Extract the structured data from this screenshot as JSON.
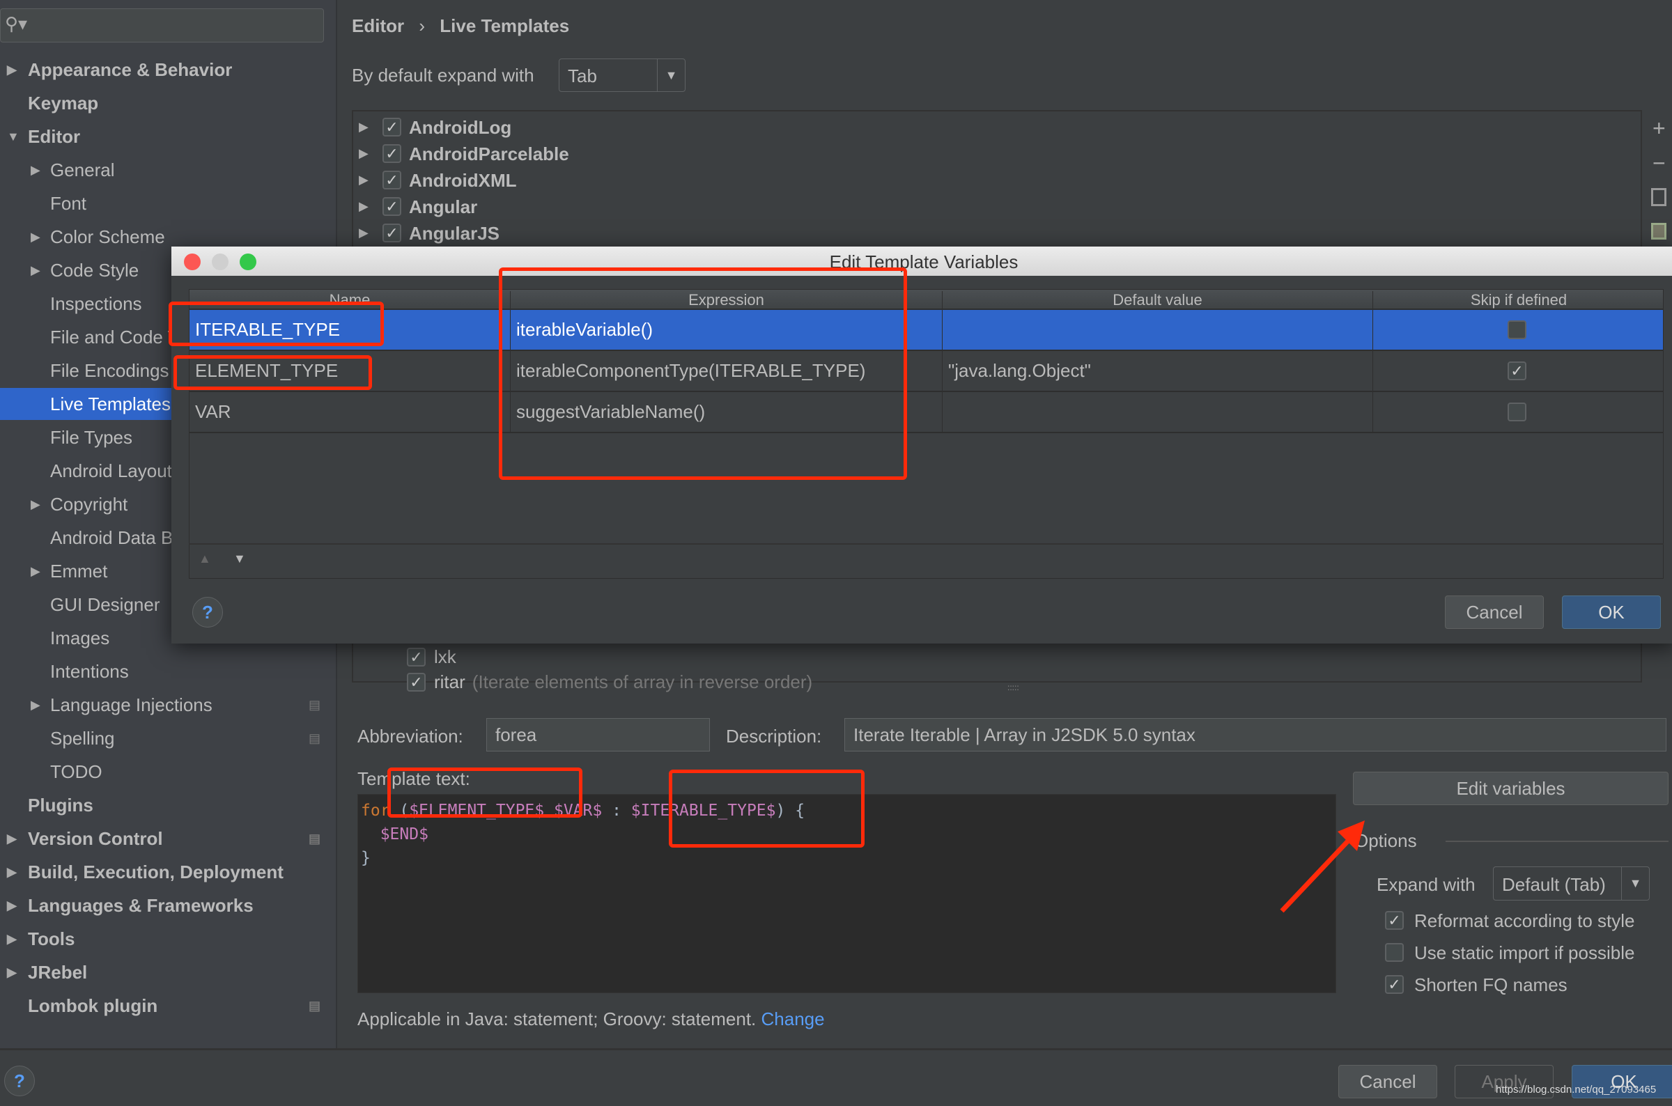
{
  "sidebar": {
    "items": [
      {
        "label": "Appearance & Behavior",
        "level": 0,
        "arrow": "right"
      },
      {
        "label": "Keymap",
        "level": 0
      },
      {
        "label": "Editor",
        "level": 0,
        "arrow": "down"
      },
      {
        "label": "General",
        "level": 1,
        "arrow": "right"
      },
      {
        "label": "Font",
        "level": 1
      },
      {
        "label": "Color Scheme",
        "level": 1,
        "arrow": "right"
      },
      {
        "label": "Code Style",
        "level": 1,
        "arrow": "right"
      },
      {
        "label": "Inspections",
        "level": 1
      },
      {
        "label": "File and Code Templates",
        "level": 1
      },
      {
        "label": "File Encodings",
        "level": 1
      },
      {
        "label": "Live Templates",
        "level": 1,
        "selected": true
      },
      {
        "label": "File Types",
        "level": 1
      },
      {
        "label": "Android Layout Editor",
        "level": 1
      },
      {
        "label": "Copyright",
        "level": 1,
        "arrow": "right"
      },
      {
        "label": "Android Data Binding",
        "level": 1
      },
      {
        "label": "Emmet",
        "level": 1,
        "arrow": "right"
      },
      {
        "label": "GUI Designer",
        "level": 1
      },
      {
        "label": "Images",
        "level": 1
      },
      {
        "label": "Intentions",
        "level": 1
      },
      {
        "label": "Language Injections",
        "level": 1,
        "arrow": "right",
        "pin": true
      },
      {
        "label": "Spelling",
        "level": 1,
        "pin": true
      },
      {
        "label": "TODO",
        "level": 1
      },
      {
        "label": "Plugins",
        "level": 0
      },
      {
        "label": "Version Control",
        "level": 0,
        "arrow": "right",
        "pin": true
      },
      {
        "label": "Build, Execution, Deployment",
        "level": 0,
        "arrow": "right"
      },
      {
        "label": "Languages & Frameworks",
        "level": 0,
        "arrow": "right"
      },
      {
        "label": "Tools",
        "level": 0,
        "arrow": "right"
      },
      {
        "label": "JRebel",
        "level": 0,
        "arrow": "right"
      },
      {
        "label": "Lombok plugin",
        "level": 0,
        "pin": true
      }
    ]
  },
  "breadcrumb": {
    "parent": "Editor",
    "sep": "›",
    "current": "Live Templates"
  },
  "expand": {
    "label": "By default expand with",
    "value": "Tab"
  },
  "groups": [
    "AndroidLog",
    "AndroidParcelable",
    "AndroidXML",
    "Angular",
    "AngularJS"
  ],
  "templates_behind": [
    {
      "abbr": "lxk",
      "desc": ""
    },
    {
      "abbr": "ritar",
      "desc": "(Iterate elements of array in reverse order)"
    }
  ],
  "dialog": {
    "title": "Edit Template Variables",
    "columns": [
      "Name",
      "Expression",
      "Default value",
      "Skip if defined"
    ],
    "rows": [
      {
        "name": "ITERABLE_TYPE",
        "expression": "iterableVariable()",
        "default": "",
        "skip": false,
        "selected": true
      },
      {
        "name": "ELEMENT_TYPE",
        "expression": "iterableComponentType(ITERABLE_TYPE)",
        "default": "\"java.lang.Object\"",
        "skip": true
      },
      {
        "name": "VAR",
        "expression": "suggestVariableName()",
        "default": "",
        "skip": false
      }
    ],
    "cancel": "Cancel",
    "ok": "OK",
    "help": "?"
  },
  "abbreviation": {
    "label": "Abbreviation:",
    "value": "forea"
  },
  "description": {
    "label": "Description:",
    "value": "Iterate Iterable | Array in J2SDK 5.0 syntax"
  },
  "template_text": {
    "label": "Template text:",
    "kw": "for",
    "l1a": " (",
    "v1": "$ELEMENT_TYPE$",
    "sp": " ",
    "v2": "$VAR$",
    "colon": " : ",
    "v3": "$ITERABLE_TYPE$",
    "l1b": ") {",
    "v4": "$END$",
    "close": "}"
  },
  "edit_variables": "Edit variables",
  "options": {
    "title": "Options",
    "expand_label": "Expand with",
    "expand_value": "Default (Tab)",
    "checks": [
      {
        "label": "Reformat according to style",
        "checked": true
      },
      {
        "label": "Use static import if possible",
        "checked": false
      },
      {
        "label": "Shorten FQ names",
        "checked": true
      }
    ]
  },
  "applicable": {
    "text": "Applicable in Java: statement; Groovy: statement.",
    "link": "Change"
  },
  "footer": {
    "cancel": "Cancel",
    "apply": "Apply",
    "ok": "OK",
    "help": "?"
  },
  "watermark": "https://blog.csdn.net/qq_27093465",
  "colors": {
    "selection": "#2f65ca",
    "annotation": "#ff2a0a",
    "link": "#589df6",
    "variable": "#c77dbb",
    "keyword": "#cc7832"
  }
}
